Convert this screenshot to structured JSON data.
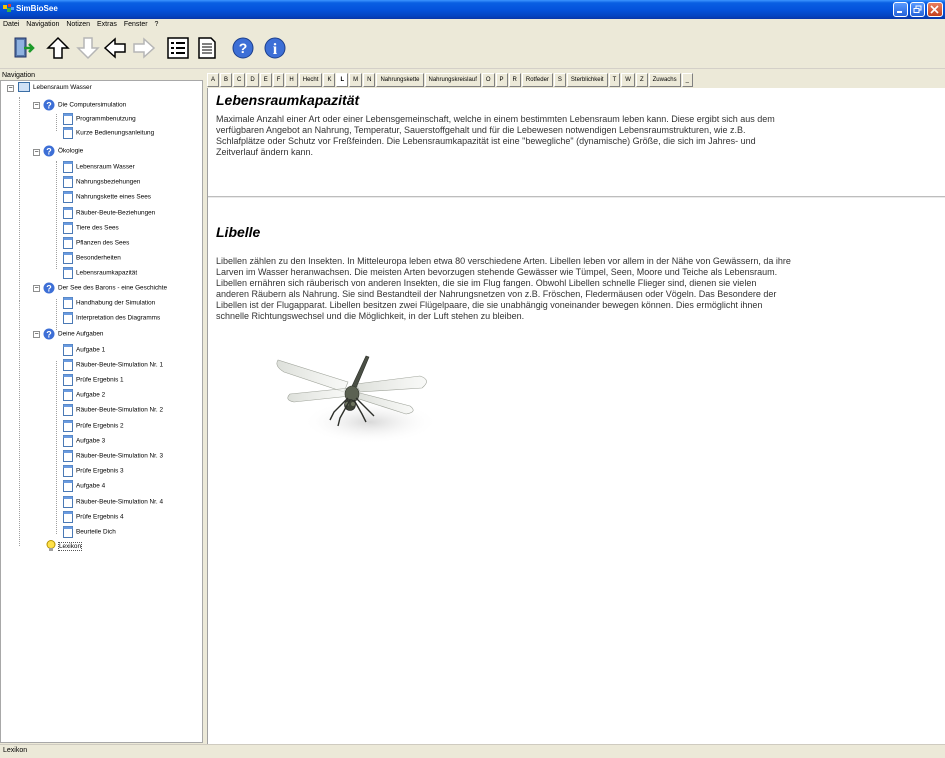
{
  "window": {
    "title": "SimBioSee"
  },
  "menu": [
    "Datei",
    "Navigation",
    "Notizen",
    "Extras",
    "Fenster",
    "?"
  ],
  "toolbar": {
    "buttons": [
      "exit-icon",
      "arrow-up-icon",
      "arrow-down-icon",
      "arrow-left-icon",
      "arrow-right-icon",
      "list-icon",
      "document-icon",
      "help-icon",
      "info-icon"
    ]
  },
  "navigation": {
    "label": "Navigation",
    "root": "Lebensraum Wasser",
    "groups": [
      {
        "label": "Die Computersimulation",
        "items": [
          "Programmbenutzung",
          "Kurze Bedienungsanleitung"
        ]
      },
      {
        "label": "Ökologie",
        "items": [
          "Lebensraum Wasser",
          "Nahrungsbeziehungen",
          "Nahrungskette eines Sees",
          "Räuber-Beute-Beziehungen",
          "Tiere des Sees",
          "Pflanzen des Sees",
          "Besonderheiten",
          "Lebensraumkapazität"
        ]
      },
      {
        "label": "Der See des Barons - eine Geschichte",
        "items": [
          "Handhabung der Simulation",
          "Interpretation des Diagramms"
        ]
      },
      {
        "label": "Deine Aufgaben",
        "items": [
          "Aufgabe 1",
          "Räuber-Beute-Simulation Nr. 1",
          "Prüfe Ergebnis 1",
          "Aufgabe 2",
          "Räuber-Beute-Simulation Nr. 2",
          "Prüfe Ergebnis 2",
          "Aufgabe 3",
          "Räuber-Beute-Simulation Nr. 3",
          "Prüfe Ergebnis 3",
          "Aufgabe 4",
          "Räuber-Beute-Simulation Nr. 4",
          "Prüfe Ergebnis 4",
          "Beurteile Dich"
        ]
      }
    ],
    "lexikon": "Lexikon"
  },
  "tabs": [
    "A",
    "B",
    "C",
    "D",
    "E",
    "F",
    "H",
    "Hecht",
    "K",
    "L",
    "M",
    "N",
    "Nahrungskette",
    "Nahrungskreislauf",
    "O",
    "P",
    "R",
    "Rotfeder",
    "S",
    "Sterblichkeit",
    "T",
    "W",
    "Z",
    "Zuwachs",
    "_"
  ],
  "active_tab": "L",
  "entries": [
    {
      "title": "Lebensraumkapazität",
      "lines": [
        "Maximale Anzahl einer Art oder einer Lebensgemeinschaft, welche in einem bestimmten Lebensraum leben kann. Diese ergibt sich aus dem",
        "verfügbaren Angebot an Nahrung, Temperatur, Sauerstoffgehalt und für die Lebewesen notwendigen Lebensraumstrukturen, wie z.B.",
        "Schlafplätze oder Schutz vor Freßfeinden. Die Lebensraumkapazität ist eine \"bewegliche\" (dynamische) Größe, die sich im Jahres- und",
        "Zeitverlauf ändern kann."
      ]
    },
    {
      "title": "Libelle",
      "lines": [
        "Libellen zählen zu den Insekten. In Mitteleuropa leben etwa 80 verschiedene Arten. Libellen leben vor allem in der Nähe von Gewässern, da ihre",
        "Larven im Wasser heranwachsen. Die meisten Arten bevorzugen stehende Gewässer wie Tümpel, Seen, Moore und Teiche als Lebensraum.",
        "Libellen ernähren sich räuberisch von anderen Insekten, die sie im Flug fangen. Obwohl Libellen schnelle Flieger sind, dienen sie vielen",
        "anderen Räubern als Nahrung. Sie sind Bestandteil der Nahrungsnetzen von z.B. Fröschen, Fledermäusen oder Vögeln. Das Besondere der",
        "Libellen ist der Flugapparat. Libellen besitzen zwei Flügelpaare, die sie unabhängig voneinander bewegen können. Dies ermöglicht ihnen",
        "schnelle Richtungswechsel und die Möglichkeit, in der Luft stehen zu bleiben."
      ]
    }
  ],
  "status": "Lexikon"
}
